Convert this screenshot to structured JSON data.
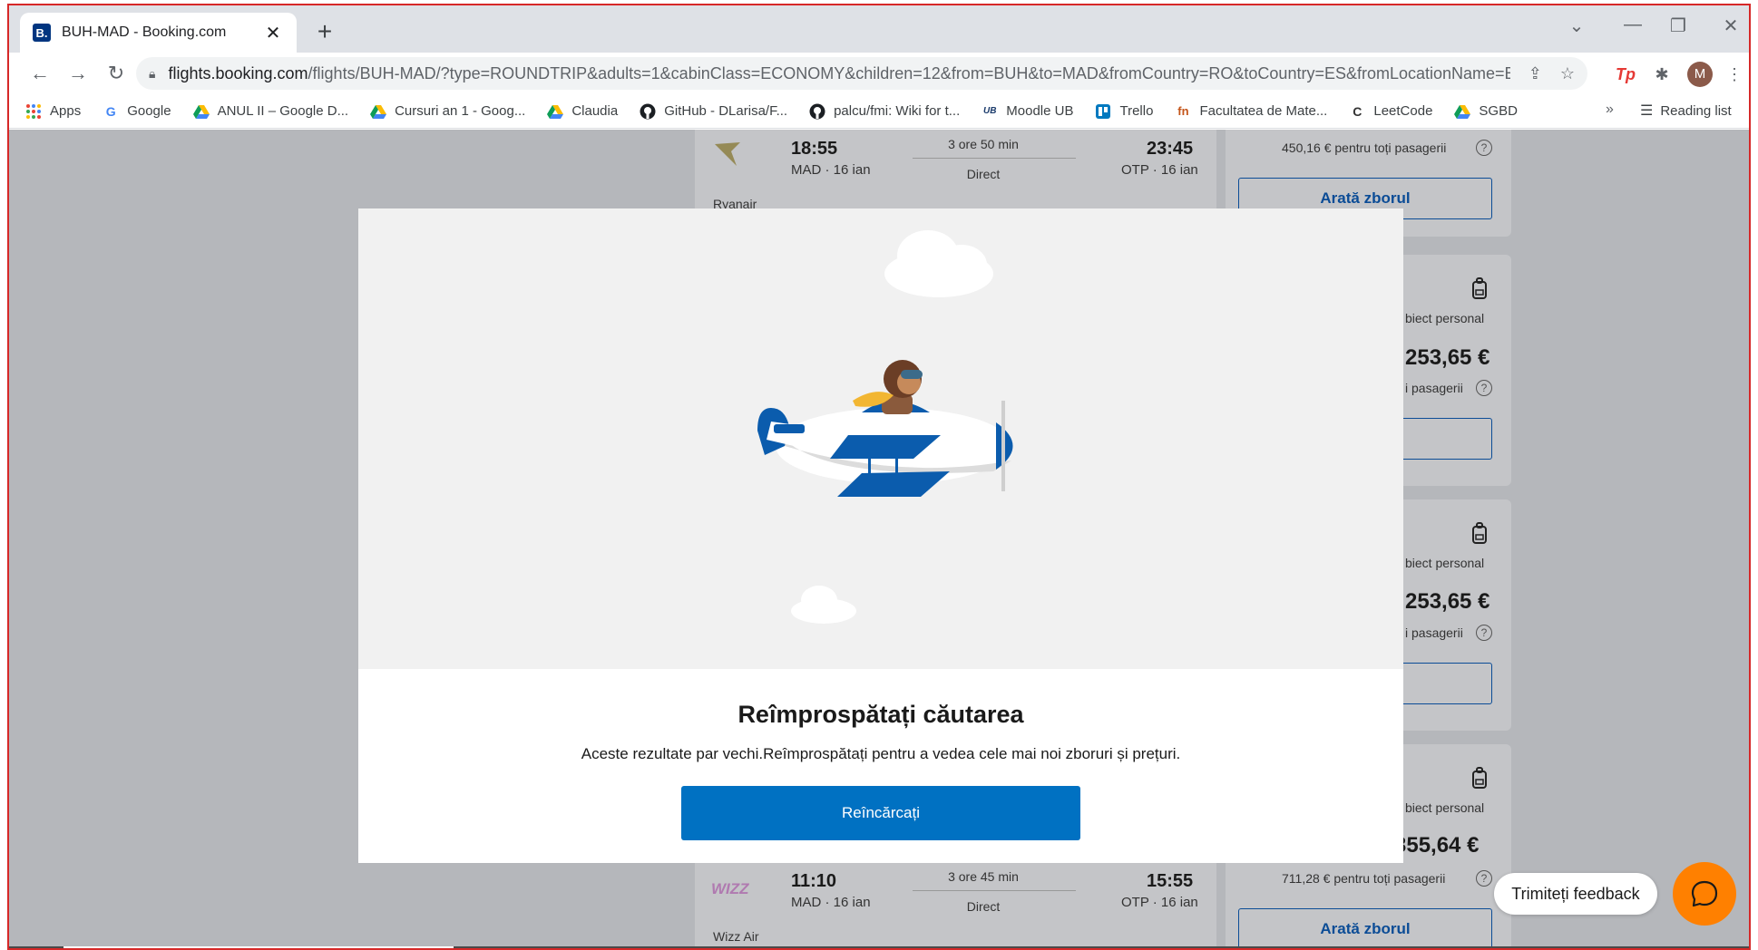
{
  "browser": {
    "tab_title": "BUH-MAD - Booking.com",
    "tab_favicon": "B.",
    "url_host": "flights.booking.com",
    "url_rest": "/flights/BUH-MAD/?type=ROUNDTRIP&adults=1&cabinClass=ECONOMY&children=12&from=BUH&to=MAD&fromCountry=RO&toCountry=ES&fromLocationName=B...",
    "avatar_letter": "M",
    "bookmarks": [
      {
        "label": "Apps",
        "icon": "apps-grid-icon"
      },
      {
        "label": "Google",
        "icon": "google-icon"
      },
      {
        "label": "ANUL II – Google D...",
        "icon": "drive-icon"
      },
      {
        "label": "Cursuri an 1 - Goog...",
        "icon": "drive-icon"
      },
      {
        "label": "Claudia",
        "icon": "drive-icon"
      },
      {
        "label": "GitHub - DLarisa/F...",
        "icon": "github-icon"
      },
      {
        "label": "palcu/fmi: Wiki for t...",
        "icon": "github-icon"
      },
      {
        "label": "Moodle UB",
        "icon": "ub-icon"
      },
      {
        "label": "Trello",
        "icon": "trello-icon"
      },
      {
        "label": "Facultatea de Mate...",
        "icon": "fmi-icon"
      },
      {
        "label": "LeetCode",
        "icon": "leetcode-icon"
      },
      {
        "label": "SGBD",
        "icon": "drive-icon"
      }
    ],
    "bookmarks_more": "»",
    "reading_list": "Reading list"
  },
  "results": {
    "flight_top": {
      "depart_time": "18:55",
      "depart_meta": "MAD · 16 ian",
      "duration": "3 ore 50 min",
      "stops": "Direct",
      "arrive_time": "23:45",
      "arrive_meta": "OTP · 16 ian",
      "airline": "Ryanair",
      "total_text": "450,16 € pentru toți pasagerii",
      "button": "Arată zborul"
    },
    "side_cards": [
      {
        "bag_text": "biect personal",
        "price": "253,65 €",
        "pax_text": "i pasagerii"
      },
      {
        "bag_text": "biect personal",
        "price": "253,65 €",
        "pax_text": "i pasagerii"
      },
      {
        "bag_text": "biect personal",
        "price": "355,64 €",
        "pax_text": ""
      }
    ],
    "flight_bottom": {
      "depart_time": "11:10",
      "depart_meta": "MAD · 16 ian",
      "duration": "3 ore 45 min",
      "stops": "Direct",
      "arrive_time": "15:55",
      "arrive_meta": "OTP · 16 ian",
      "airline": "Wizz Air",
      "airline_logo": "WIZZ",
      "total_text": "711,28 € pentru toți pasagerii",
      "button": "Arată zborul"
    }
  },
  "modal": {
    "title": "Reîmprospătați căutarea",
    "text": "Aceste rezultate par vechi.Reîmprospătați pentru a vedea cele mai noi zboruri și prețuri.",
    "button": "Reîncărcați"
  },
  "feedback": {
    "label": "Trimiteți feedback"
  },
  "colors": {
    "brand_blue": "#0071c2",
    "chat_orange": "#ff8000",
    "overlay": "#b5b7bb"
  }
}
